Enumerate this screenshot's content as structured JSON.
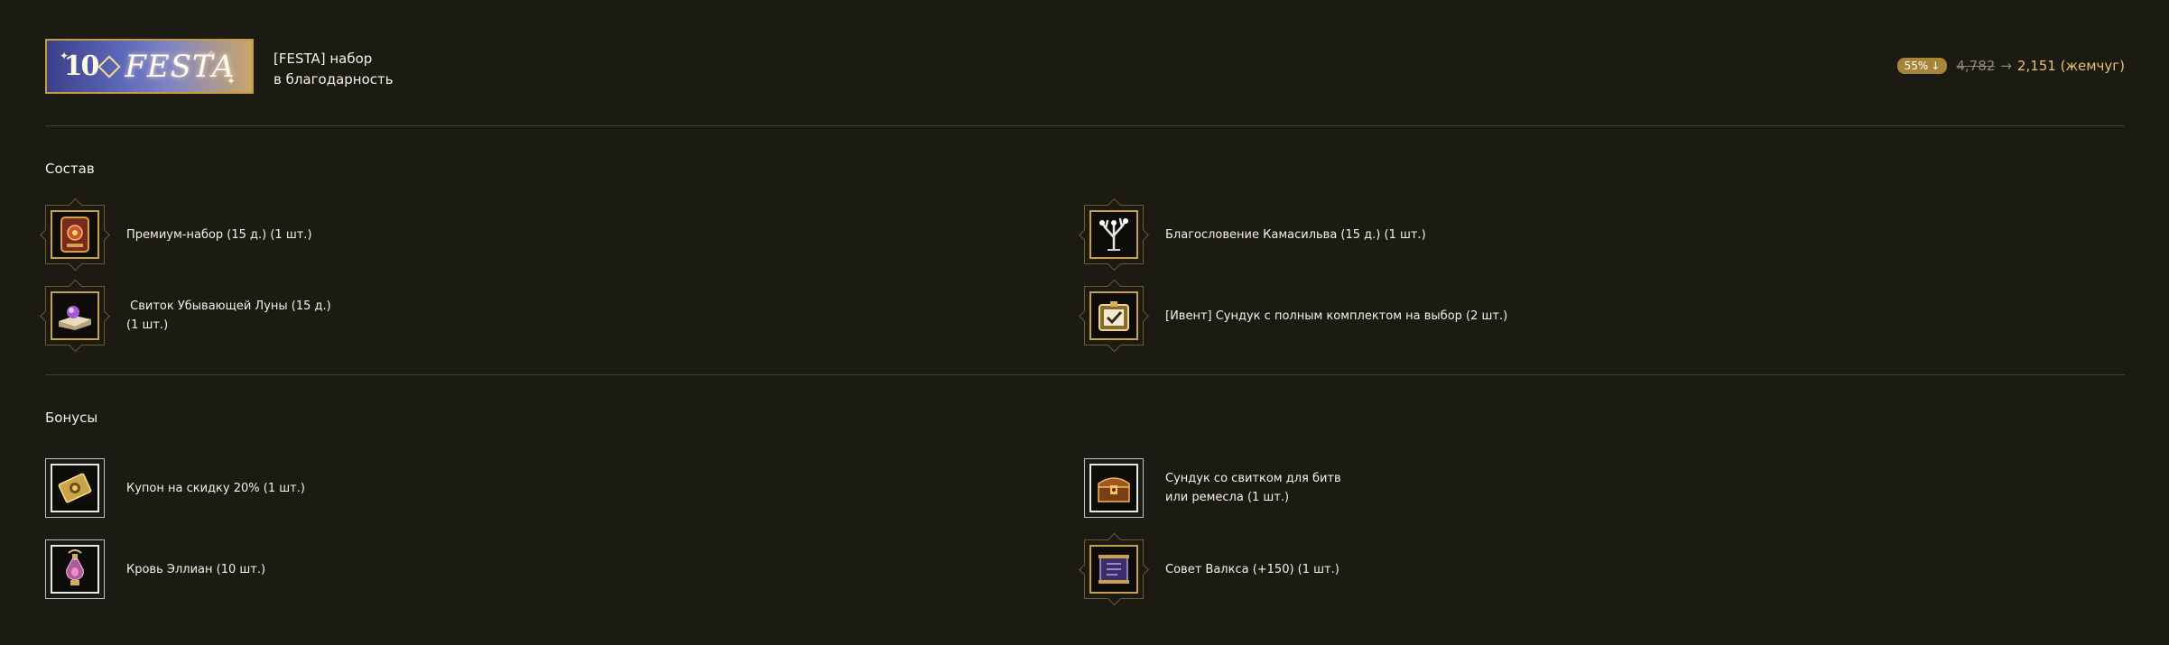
{
  "header": {
    "banner_number": "10",
    "banner_text": "FESTA",
    "title_line1": "[FESTA] набор",
    "title_line2": "в благодарность"
  },
  "price": {
    "discount": "55%",
    "old_price": "4,782",
    "arrow": "→",
    "new_price": "2,151 (жемчуг)"
  },
  "sections": {
    "contents_title": "Состав",
    "bonuses_title": "Бонусы"
  },
  "contents": [
    {
      "label_line1": "Премиум-набор (15 д.) (1 шт.)",
      "label_line2": "",
      "icon": "premium-pack-icon"
    },
    {
      "label_line1": "Благословение Камасильва (15 д.) (1 шт.)",
      "label_line2": "",
      "icon": "kamasylve-blessing-icon"
    },
    {
      "label_line1": " Свиток Убывающей Луны (15 д.)",
      "label_line2": "(1 шт.)",
      "icon": "waning-moon-scroll-icon"
    },
    {
      "label_line1": "[Ивент] Сундук с полным комплектом на выбор (2 шт.)",
      "label_line2": "",
      "icon": "event-chest-icon"
    }
  ],
  "bonuses": [
    {
      "label_line1": "Купон на скидку 20% (1 шт.)",
      "label_line2": "",
      "icon": "discount-coupon-icon"
    },
    {
      "label_line1": "Сундук со свитком для битв",
      "label_line2": "или ремесла (1 шт.)",
      "icon": "scroll-chest-icon"
    },
    {
      "label_line1": "Кровь Эллиан (10 шт.)",
      "label_line2": "",
      "icon": "elion-blood-icon"
    },
    {
      "label_line1": "Совет Валкса (+150) (1 шт.)",
      "label_line2": "",
      "icon": "valks-advice-icon"
    }
  ],
  "colors": {
    "background": "#1b1a13",
    "gold_frame": "#c9a04e",
    "price_accent": "#e8c06a",
    "badge": "#a8843a"
  }
}
